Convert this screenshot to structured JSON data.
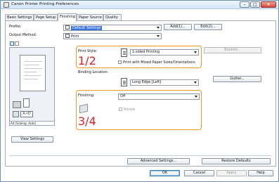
{
  "window": {
    "title": "Canon Printer Printing Preferences",
    "controls": {
      "minimize": "–",
      "maximize": "□",
      "close": "×"
    }
  },
  "tabs": [
    {
      "label": "Basic Settings"
    },
    {
      "label": "Page Setup"
    },
    {
      "label": "Finishing"
    },
    {
      "label": "Paper Source"
    },
    {
      "label": "Quality"
    }
  ],
  "active_tab": "Finishing",
  "profile": {
    "label": "Profile:",
    "value": "Default Settings",
    "add_button": "Add(1)...",
    "edit_button": "Edit(2)..."
  },
  "output_method": {
    "label": "Output Method:",
    "value": "Print"
  },
  "print_style": {
    "label": "Print Style:",
    "value": "1-sided Printing",
    "mixed_checkbox": "Print with Mixed Paper Sizes/Orientations",
    "booklet_button": "Booklet..."
  },
  "binding": {
    "label": "Binding Location:",
    "value": "Long Edge [Left]",
    "gutter_button": "Gutter..."
  },
  "finishing": {
    "label": "Finishing:",
    "value": "Off",
    "rotate_checkbox": "Rotate"
  },
  "annotations": {
    "step_a": "1/2",
    "step_b": "3/4"
  },
  "preview": {
    "caption": "A4 [Scaling: Auto]",
    "view_settings_button": "View Settings"
  },
  "bottom": {
    "advanced_settings_button": "Advanced Settings...",
    "restore_defaults_button": "Restore Defaults",
    "ok_button": "OK",
    "cancel_button": "Cancel",
    "apply_button": "Apply",
    "help_button": "Help"
  },
  "colors": {
    "highlight_orange": "#f29a1f",
    "annotation_red": "#e21d24",
    "selected_blue": "#3874d8"
  }
}
